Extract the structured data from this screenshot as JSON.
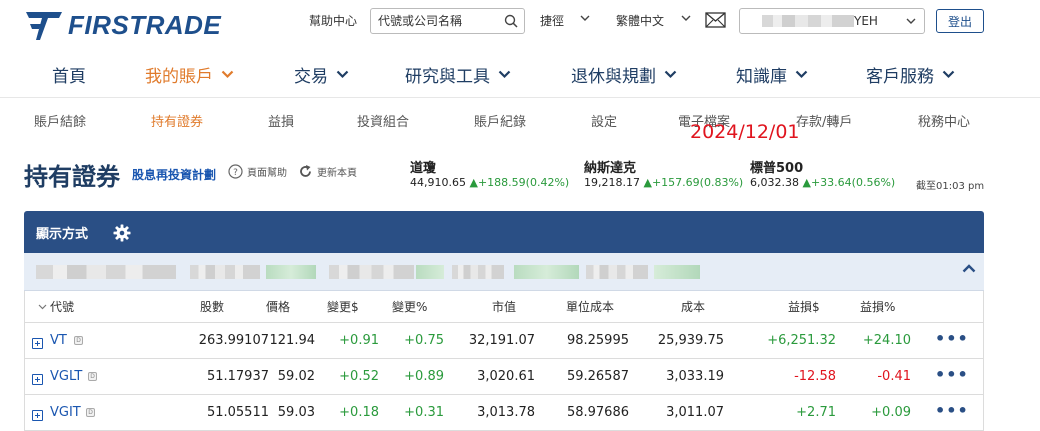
{
  "brand": {
    "name": "FIRSTRADE"
  },
  "topbar": {
    "help": "幫助中心",
    "search_placeholder": "代號或公司名稱",
    "shortcut": "捷徑",
    "language": "繁體中文",
    "user_suffix": "YEH",
    "logout": "登出"
  },
  "mainnav": [
    {
      "label": "首頁"
    },
    {
      "label": "我的賬戶"
    },
    {
      "label": "交易"
    },
    {
      "label": "研究與工具"
    },
    {
      "label": "退休與規劃"
    },
    {
      "label": "知識庫"
    },
    {
      "label": "客戶服務"
    }
  ],
  "subnav": [
    {
      "label": "賬戶結餘"
    },
    {
      "label": "持有證券"
    },
    {
      "label": "益損"
    },
    {
      "label": "投資組合"
    },
    {
      "label": "賬戶紀錄"
    },
    {
      "label": "設定"
    },
    {
      "label": "電子檔案"
    },
    {
      "label": "存款/轉戶"
    },
    {
      "label": "稅務中心"
    }
  ],
  "annotation_date": "2024/12/01",
  "page": {
    "title": "持有證券",
    "drip_link": "股息再投資計劃",
    "page_help": "頁面幫助",
    "refresh": "更新本頁"
  },
  "indices": [
    {
      "name": "道瓊",
      "value": "44,910.65",
      "change": "+188.59(0.42%)"
    },
    {
      "name": "納斯達克",
      "value": "19,218.17",
      "change": "+157.69(0.83%)"
    },
    {
      "name": "標普500",
      "value": "6,032.38",
      "change": "+33.64(0.56%)"
    }
  ],
  "as_of": "截至01:03 pm",
  "panel": {
    "title": "顯示方式"
  },
  "table": {
    "headers": {
      "symbol": "代號",
      "qty": "股數",
      "price": "價格",
      "chg": "變更$",
      "chg_pct": "變更%",
      "mkt_value": "市值",
      "unit_cost": "單位成本",
      "cost": "成本",
      "gl": "益損$",
      "gl_pct": "益損%"
    },
    "rows": [
      {
        "symbol": "VT",
        "qty": "263.99107",
        "price": "121.94",
        "chg": "+0.91",
        "chg_pct": "+0.75",
        "mkt_value": "32,191.07",
        "unit_cost": "98.25995",
        "cost": "25,939.75",
        "gl": "+6,251.32",
        "gl_pct": "+24.10",
        "gl_sign": "pos"
      },
      {
        "symbol": "VGLT",
        "qty": "51.17937",
        "price": "59.02",
        "chg": "+0.52",
        "chg_pct": "+0.89",
        "mkt_value": "3,020.61",
        "unit_cost": "59.26587",
        "cost": "3,033.19",
        "gl": "-12.58",
        "gl_pct": "-0.41",
        "gl_sign": "neg"
      },
      {
        "symbol": "VGIT",
        "qty": "51.05511",
        "price": "59.03",
        "chg": "+0.18",
        "chg_pct": "+0.31",
        "mkt_value": "3,013.78",
        "unit_cost": "58.97686",
        "cost": "3,011.07",
        "gl": "+2.71",
        "gl_pct": "+0.09",
        "gl_sign": "pos"
      }
    ],
    "more": "•••",
    "d_badge": "D"
  },
  "colors": {
    "brand": "#1e4f8c",
    "accent": "#e07b2c",
    "panel": "#2a4f85",
    "positive": "#2a9a3c",
    "negative": "#e0141e"
  }
}
